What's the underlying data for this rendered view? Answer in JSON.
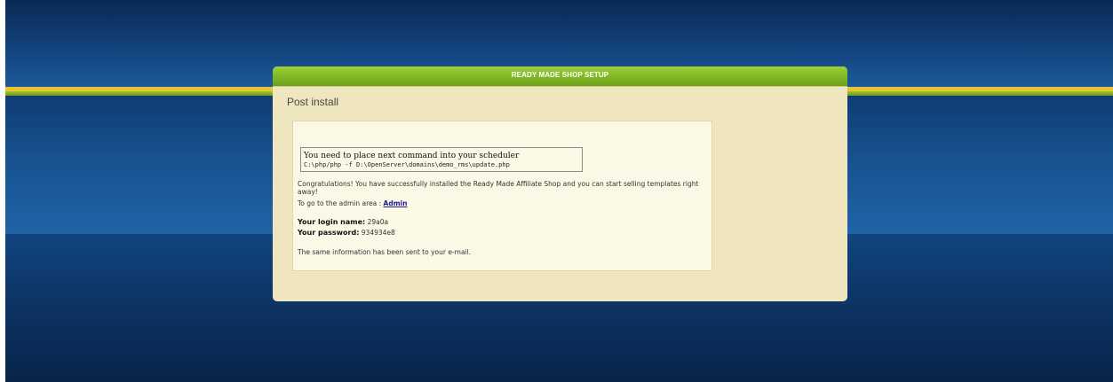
{
  "panel": {
    "header_title": "READY MADE SHOP SETUP",
    "section_title": "Post install"
  },
  "scheduler": {
    "title": "You need to place next command into your scheduler",
    "command": "C:\\php/php -f D:\\OpenServer\\domains\\demo_rms\\update.php"
  },
  "message": {
    "congrats": "Congratulations! You have successfully installed the Ready Made Affiliate Shop and you can start selling templates right away!",
    "admin_prefix": "To go to the admin area : ",
    "admin_link": "Admin",
    "login_label": "Your login name:",
    "login_value": "29a0a",
    "password_label": "Your password:",
    "password_value": "934934e8",
    "email_note": "The same information has been sent to your e-mail."
  },
  "colors": {
    "header_green": "#7db424",
    "panel_beige": "#efe5bf",
    "background_blue": "#1c5696",
    "stripe_yellow": "#e9c531"
  }
}
